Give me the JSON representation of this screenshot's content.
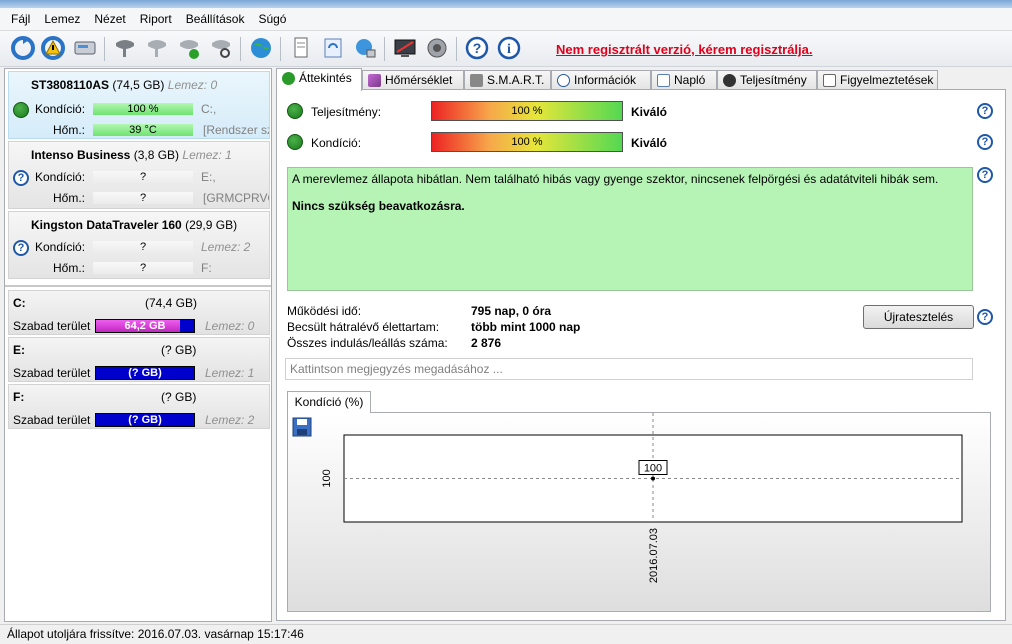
{
  "menu": [
    "Fájl",
    "Lemez",
    "Nézet",
    "Riport",
    "Beállítások",
    "Súgó"
  ],
  "toolbar": {
    "register_text": "Nem regisztrált verzió, kérem regisztrálja."
  },
  "disks": [
    {
      "name": "ST3808110AS",
      "size": "(74,5 GB)",
      "disk_label": "Lemez: 0",
      "cond_label": "Kondíció:",
      "cond_value": "100 %",
      "cond_drive": "C:,",
      "temp_label": "Hőm.:",
      "temp_value": "39 °C",
      "temp_extra": "[Rendszer szá",
      "status": "ok"
    },
    {
      "name": "Intenso Business",
      "size": "(3,8 GB)",
      "disk_label": "Lemez: 1",
      "cond_label": "Kondíció:",
      "cond_value": "?",
      "cond_drive": "E:,",
      "temp_label": "Hőm.:",
      "temp_value": "?",
      "temp_extra": "[GRMCPRVO",
      "status": "unknown"
    },
    {
      "name": "Kingston DataTraveler 160",
      "size": "(29,9 GB)",
      "disk_label": "Lemez: 2",
      "cond_label": "Kondíció:",
      "cond_value": "?",
      "cond_drive": "Lemez: 2",
      "temp_label": "Hőm.:",
      "temp_value": "?",
      "temp_extra": "F:",
      "status": "unknown"
    }
  ],
  "volumes": [
    {
      "letter": "C:",
      "size": "(74,4 GB)",
      "free_label": "Szabad terület",
      "free_value": "64,2 GB",
      "disk": "Lemez: 0",
      "free_fraction": 0.86
    },
    {
      "letter": "E:",
      "size": "(? GB)",
      "free_label": "Szabad terület",
      "free_value": "(? GB)",
      "disk": "Lemez: 1",
      "free_fraction": 0
    },
    {
      "letter": "F:",
      "size": "(? GB)",
      "free_label": "Szabad terület",
      "free_value": "(? GB)",
      "disk": "Lemez: 2",
      "free_fraction": 0
    }
  ],
  "tabs": [
    "Áttekintés",
    "Hőmérséklet",
    "S.M.A.R.T.",
    "Információk",
    "Napló",
    "Teljesítmény",
    "Figyelmeztetések"
  ],
  "overview": {
    "perf_label": "Teljesítmény:",
    "perf_value": "100 %",
    "perf_rating": "Kiváló",
    "cond_label": "Kondíció:",
    "cond_value": "100 %",
    "cond_rating": "Kiváló",
    "message": "A merevlemez állapota hibátlan. Nem található hibás vagy gyenge szektor, nincsenek felpörgési és adatátviteli hibák sem.",
    "message_bold": "Nincs szükség beavatkozásra.",
    "uptime_label": "Működési idő:",
    "uptime_value": "795 nap, 0 óra",
    "life_label": "Becsült hátralévő élettartam:",
    "life_value": "több mint 1000 nap",
    "starts_label": "Összes indulás/leállás száma:",
    "starts_value": "2 876",
    "retest_button": "Újratesztelés",
    "note_placeholder": "Kattintson megjegyzés megadásához ...",
    "chart_tab": "Kondíció  (%)"
  },
  "chart_data": {
    "type": "scatter",
    "x": [
      "2016.07.03"
    ],
    "values": [
      100
    ],
    "ylabel": "",
    "y_tick": "100",
    "point_label": "100",
    "grid": true
  },
  "status": {
    "text": "Állapot utoljára frissítve: 2016.07.03. vasárnap 15:17:46"
  }
}
